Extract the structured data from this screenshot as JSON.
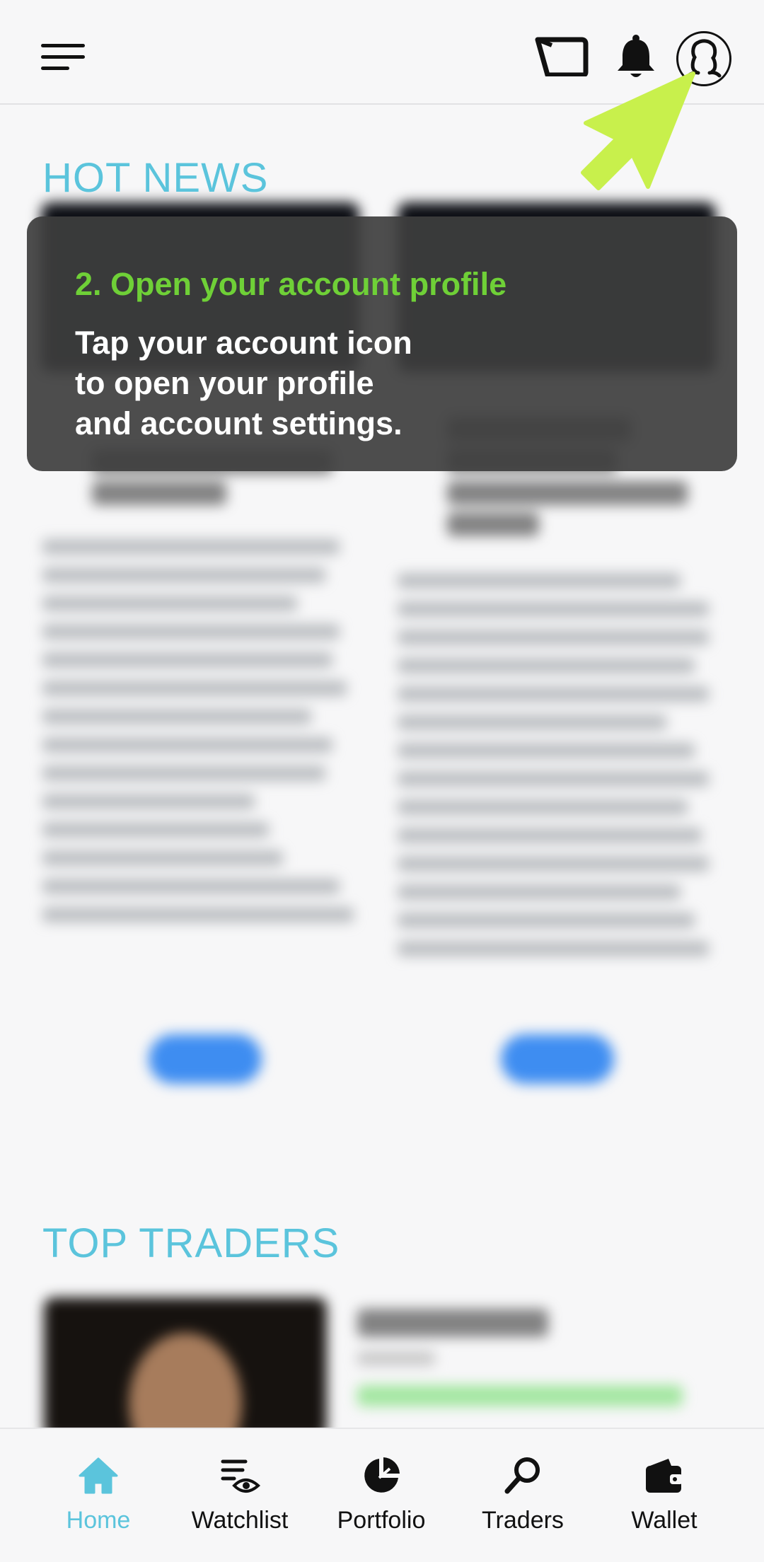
{
  "sections": {
    "hot_news_title": "HOT NEWS",
    "top_traders_title": "TOP TRADERS"
  },
  "tooltip": {
    "title": "2. Open your account profile",
    "body_line1": "Tap your account icon",
    "body_line2": "to open your profile",
    "body_line3": "and account settings."
  },
  "bottom_nav": {
    "items": [
      {
        "label": "Home",
        "icon": "home-icon",
        "active": true
      },
      {
        "label": "Watchlist",
        "icon": "watchlist-icon",
        "active": false
      },
      {
        "label": "Portfolio",
        "icon": "pie-chart-icon",
        "active": false
      },
      {
        "label": "Traders",
        "icon": "search-icon",
        "active": false
      },
      {
        "label": "Wallet",
        "icon": "wallet-icon",
        "active": false
      }
    ]
  },
  "colors": {
    "accent": "#5bc4dc",
    "tooltip_title": "#6fd037",
    "pointer": "#c8f04c",
    "button_blue": "#3e8df1"
  },
  "header_icons": [
    "menu-icon",
    "tablet-icon",
    "bell-icon",
    "account-icon"
  ]
}
